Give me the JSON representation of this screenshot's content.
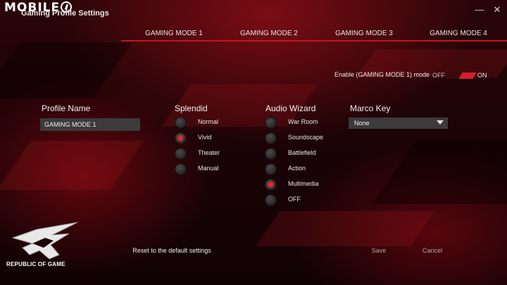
{
  "watermark": {
    "text": "MOBILE"
  },
  "window": {
    "title": "Gaming Profile Settings",
    "minimize_glyph": "—",
    "close_glyph": "✕"
  },
  "tabs": [
    {
      "label": "GAMING MODE 1",
      "active": true
    },
    {
      "label": "GAMING MODE 2",
      "active": false
    },
    {
      "label": "GAMING MODE 3",
      "active": false
    },
    {
      "label": "GAMING MODE 4",
      "active": false
    }
  ],
  "enable": {
    "label": "Enable (GAMING MODE 1) mode",
    "off": "OFF",
    "on": "ON",
    "state": "on"
  },
  "profile": {
    "heading": "Profile Name",
    "value": "GAMING MODE 1"
  },
  "splendid": {
    "heading": "Splendid",
    "options": [
      {
        "label": "Normal",
        "checked": false
      },
      {
        "label": "Vivid",
        "checked": true
      },
      {
        "label": "Theater",
        "checked": false
      },
      {
        "label": "Manual",
        "checked": false
      }
    ]
  },
  "audio": {
    "heading": "Audio Wizard",
    "options": [
      {
        "label": "War Room",
        "checked": false
      },
      {
        "label": "Soundscape",
        "checked": false
      },
      {
        "label": "Battlefield",
        "checked": false
      },
      {
        "label": "Action",
        "checked": false
      },
      {
        "label": "Multimedia",
        "checked": true
      },
      {
        "label": "OFF",
        "checked": false
      }
    ]
  },
  "macro": {
    "heading": "Marco Key",
    "selected": "None"
  },
  "buttons": {
    "reset": "Reset to the default settings",
    "save": "Save",
    "cancel": "Cancel"
  },
  "brand": {
    "text": "REPUBLIC OF GAME"
  },
  "colors": {
    "accent": "#d4202a",
    "background": "#1a0306",
    "field": "#3c3a3b"
  }
}
